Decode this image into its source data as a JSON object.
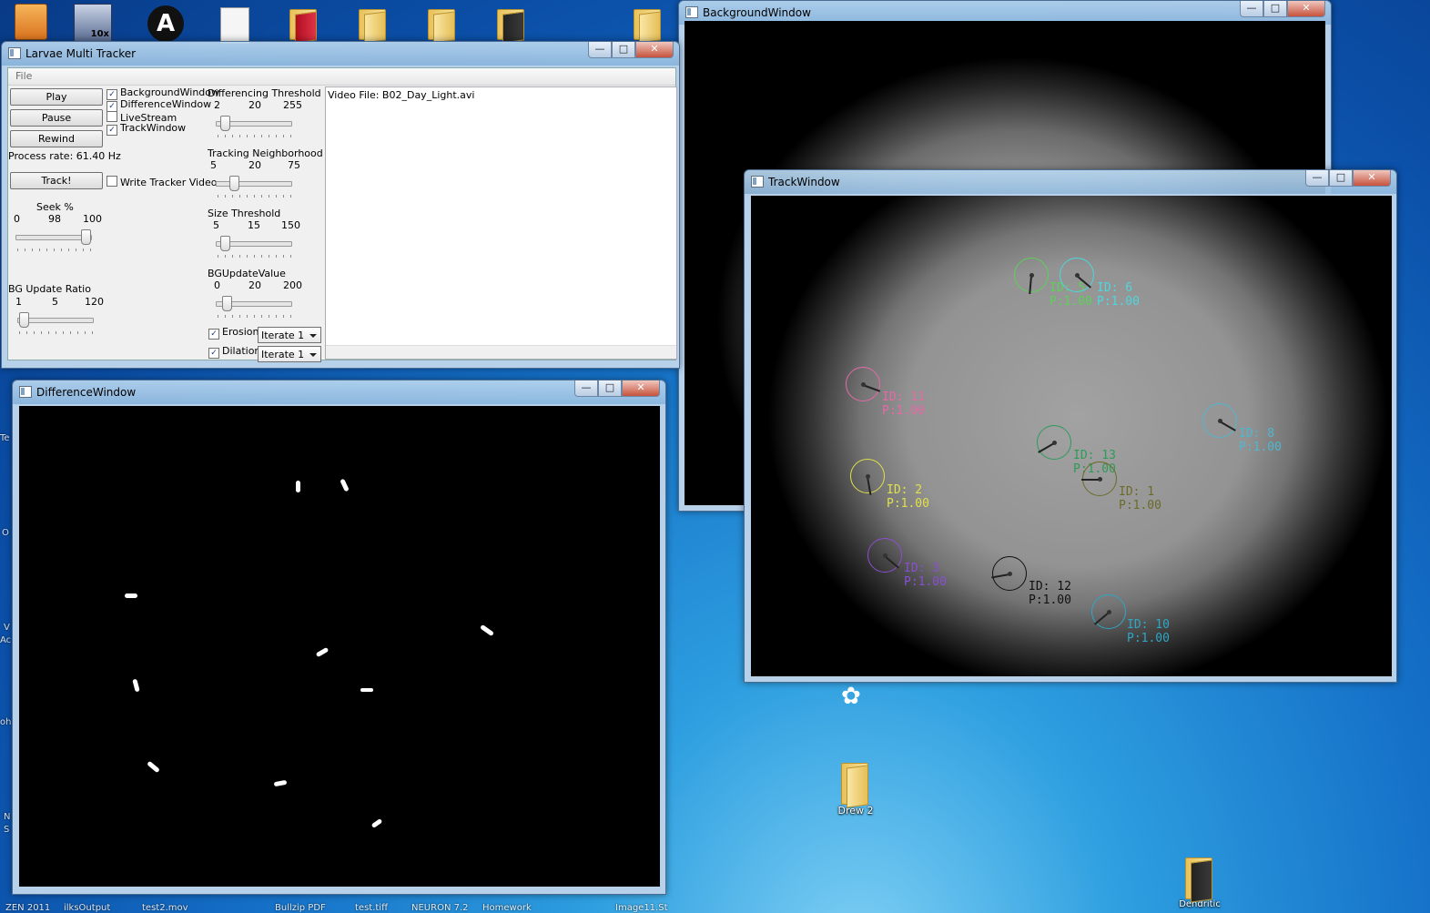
{
  "desktop": {
    "top_icons": [
      {
        "label": "",
        "kind": "app"
      },
      {
        "label": "10x",
        "kind": "app"
      },
      {
        "label": "",
        "kind": "app"
      },
      {
        "label": "",
        "kind": "file"
      },
      {
        "label": "",
        "kind": "red"
      },
      {
        "label": "",
        "kind": "folder"
      },
      {
        "label": "",
        "kind": "folder"
      },
      {
        "label": "",
        "kind": "dark"
      },
      {
        "label": "",
        "kind": "folder"
      }
    ],
    "drew_folder_label": "Drew 2",
    "dendritic_label": "Dendritic",
    "bottom_labels": [
      "ZEN 2011",
      "ilksOutput",
      "test2.mov",
      "Bullzip PDF",
      "test.tiff",
      "NEURON 7.2",
      "Homework",
      "Image11.St"
    ],
    "edge_letters": [
      "Te",
      "O",
      "V",
      "Ac",
      "oh",
      "N",
      "S"
    ]
  },
  "background_window": {
    "title": "BackgroundWindow",
    "caption": {
      "minimize": "—",
      "maximize": "□",
      "close": "✕"
    }
  },
  "track_window": {
    "title": "TrackWindow",
    "caption": {
      "minimize": "—",
      "maximize": "□",
      "close": "✕"
    },
    "tracks": [
      {
        "id_text": "ID: 5",
        "p_text": "P:1.00",
        "color": "#5cd15a"
      },
      {
        "id_text": "ID: 6",
        "p_text": "P:1.00",
        "color": "#4fd6de"
      },
      {
        "id_text": "ID: 11",
        "p_text": "P:1.00",
        "color": "#e56aa6"
      },
      {
        "id_text": "ID: 8",
        "p_text": "P:1.00",
        "color": "#4fb7d0"
      },
      {
        "id_text": "ID: 13",
        "p_text": "P:1.00",
        "color": "#2e9a5a"
      },
      {
        "id_text": "ID: 2",
        "p_text": "P:1.00",
        "color": "#e2e04a"
      },
      {
        "id_text": "ID: 3",
        "p_text": "P:1.00",
        "color": "#8a4fd0"
      },
      {
        "id_text": "ID: 12",
        "p_text": "P:1.00",
        "color": "#111111"
      },
      {
        "id_text": "ID: 10",
        "p_text": "P:1.00",
        "color": "#2ea7c6"
      },
      {
        "id_text": "ID: 1",
        "p_text": "P:1.00",
        "color": "#6b6b2a"
      }
    ]
  },
  "tracker_window": {
    "title": "Larvae Multi Tracker",
    "caption": {
      "minimize": "—",
      "maximize": "□",
      "close": "✕"
    },
    "menu_file": "File",
    "buttons": {
      "play": "Play",
      "pause": "Pause",
      "rewind": "Rewind",
      "track": "Track!"
    },
    "process_rate": "Process rate: 61.40 Hz",
    "checkboxes": {
      "background_window": {
        "label": "BackgroundWindow",
        "checked": true
      },
      "difference_window": {
        "label": "DifferenceWindow",
        "checked": true
      },
      "live_stream": {
        "label": "LiveStream",
        "checked": false
      },
      "track_window": {
        "label": "TrackWindow",
        "checked": true
      },
      "write_tracker_video": {
        "label": "Write Tracker Video",
        "checked": false
      },
      "erosion": {
        "label": "Erosion",
        "checked": true
      },
      "dilation": {
        "label": "Dilation",
        "checked": true
      }
    },
    "sliders": {
      "seek": {
        "title": "Seek %",
        "min": "0",
        "value": "98",
        "max": "100",
        "fraction": 0.98
      },
      "bg_update_ratio": {
        "title": "BG Update Ratio",
        "min": "1",
        "value": "5",
        "max": "120",
        "fraction": 0.03
      },
      "differencing_threshold": {
        "title": "Differencing Threshold",
        "min": "2",
        "value": "20",
        "max": "255",
        "fraction": 0.07
      },
      "tracking_neighborhood": {
        "title": "Tracking Neighborhood",
        "min": "5",
        "value": "20",
        "max": "75",
        "fraction": 0.21
      },
      "size_threshold": {
        "title": "Size Threshold",
        "min": "5",
        "value": "15",
        "max": "150",
        "fraction": 0.07
      },
      "bg_update_value": {
        "title": "BGUpdateValue",
        "min": "0",
        "value": "20",
        "max": "200",
        "fraction": 0.1
      }
    },
    "erosion_select": "Iterate 1",
    "dilation_select": "Iterate 1",
    "log_text": "Video File: B02_Day_Light.avi",
    "check_mark": "✓"
  },
  "difference_window": {
    "title": "DifferenceWindow",
    "caption": {
      "minimize": "—",
      "maximize": "□",
      "close": "✕"
    }
  }
}
